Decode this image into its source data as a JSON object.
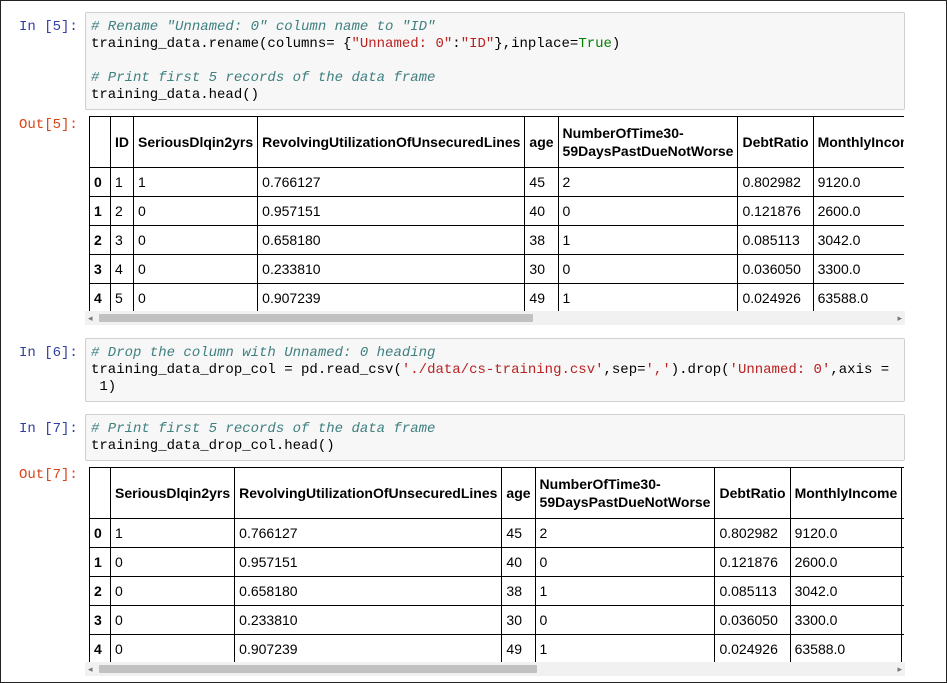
{
  "cells": [
    {
      "in_prompt": "In [5]:",
      "code": [
        {
          "comment": "# Rename \"Unnamed: 0\" column name to \"ID\""
        },
        {
          "pre": "training_data.rename(columns= {",
          "str1": "\"Unnamed: 0\"",
          "mid": ":",
          "str2": "\"ID\"",
          "post": "},inplace=",
          "kw": "True",
          "end": ")"
        },
        {
          "blank": ""
        },
        {
          "comment": "# Print first 5 records of the data frame"
        },
        {
          "plain": "training_data.head()"
        }
      ],
      "out_prompt": "Out[5]:",
      "table": {
        "columns": [
          "",
          "ID",
          "SeriousDlqin2yrs",
          "RevolvingUtilizationOfUnsecuredLines",
          "age",
          "NumberOfTime30-\n59DaysPastDueNotWorse",
          "DebtRatio",
          "MonthlyIncome"
        ],
        "rows": [
          [
            "0",
            "1",
            "1",
            "0.766127",
            "45",
            "2",
            "0.802982",
            "9120.0"
          ],
          [
            "1",
            "2",
            "0",
            "0.957151",
            "40",
            "0",
            "0.121876",
            "2600.0"
          ],
          [
            "2",
            "3",
            "0",
            "0.658180",
            "38",
            "1",
            "0.085113",
            "3042.0"
          ],
          [
            "3",
            "4",
            "0",
            "0.233810",
            "30",
            "0",
            "0.036050",
            "3300.0"
          ],
          [
            "4",
            "5",
            "0",
            "0.907239",
            "49",
            "1",
            "0.024926",
            "63588.0"
          ]
        ]
      }
    },
    {
      "in_prompt": "In [6]:",
      "code": {
        "comment": "# Drop the column with Unnamed: 0 heading",
        "pre": "training_data_drop_col = pd.read_csv(",
        "str1": "'./data/cs-training.csv'",
        "mid": ",sep=",
        "str2": "','",
        "mid2": ").drop(",
        "str3": "'Unnamed: 0'",
        "post": ",axis =",
        "wrap": " 1)"
      }
    },
    {
      "in_prompt": "In [7]:",
      "code": [
        {
          "comment": "# Print first 5 records of the data frame"
        },
        {
          "plain": "training_data_drop_col.head()"
        }
      ],
      "out_prompt": "Out[7]:",
      "table": {
        "columns": [
          "",
          "SeriousDlqin2yrs",
          "RevolvingUtilizationOfUnsecuredLines",
          "age",
          "NumberOfTime30-\n59DaysPastDueNotWorse",
          "DebtRatio",
          "MonthlyIncome",
          ""
        ],
        "rows": [
          [
            "0",
            "1",
            "0.766127",
            "45",
            "2",
            "0.802982",
            "9120.0",
            ""
          ],
          [
            "1",
            "0",
            "0.957151",
            "40",
            "0",
            "0.121876",
            "2600.0",
            ""
          ],
          [
            "2",
            "0",
            "0.658180",
            "38",
            "1",
            "0.085113",
            "3042.0",
            ""
          ],
          [
            "3",
            "0",
            "0.233810",
            "30",
            "0",
            "0.036050",
            "3300.0",
            ""
          ],
          [
            "4",
            "0",
            "0.907239",
            "49",
            "1",
            "0.024926",
            "63588.0",
            ""
          ]
        ]
      }
    }
  ],
  "scroll": {
    "left_arrow": "◂",
    "right_arrow": "▸"
  }
}
